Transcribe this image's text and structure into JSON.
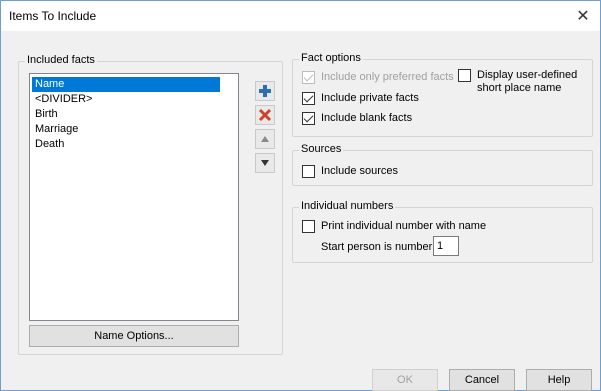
{
  "window": {
    "title": "Items To Include",
    "close_symbol": "✕"
  },
  "included_facts": {
    "label": "Included facts",
    "items": [
      "Name",
      "<DIVIDER>",
      "Birth",
      "Marriage",
      "Death"
    ],
    "selected_index": 0,
    "name_options_label": "Name Options..."
  },
  "list_actions": {
    "add": "add-fact",
    "remove": "remove-fact",
    "up": "move-up",
    "down": "move-down"
  },
  "fact_options": {
    "label": "Fact options",
    "preferred_label": "Include only preferred facts",
    "preferred_checked": true,
    "preferred_disabled": true,
    "user_place_label_line1": "Display user-defined",
    "user_place_label_line2": "short place name",
    "user_place_checked": false,
    "private_label": "Include private facts",
    "private_checked": true,
    "blank_label": "Include blank facts",
    "blank_checked": true
  },
  "sources": {
    "label": "Sources",
    "include_label": "Include sources",
    "include_checked": false
  },
  "individual_numbers": {
    "label": "Individual numbers",
    "print_label": "Print individual number with name",
    "print_checked": false,
    "start_label": "Start person is number",
    "start_value": "1"
  },
  "footer": {
    "ok": "OK",
    "cancel": "Cancel",
    "help": "Help"
  },
  "colors": {
    "selection": "#0078d7",
    "add_icon": "#2d6db5",
    "remove_icon": "#c9452b"
  }
}
